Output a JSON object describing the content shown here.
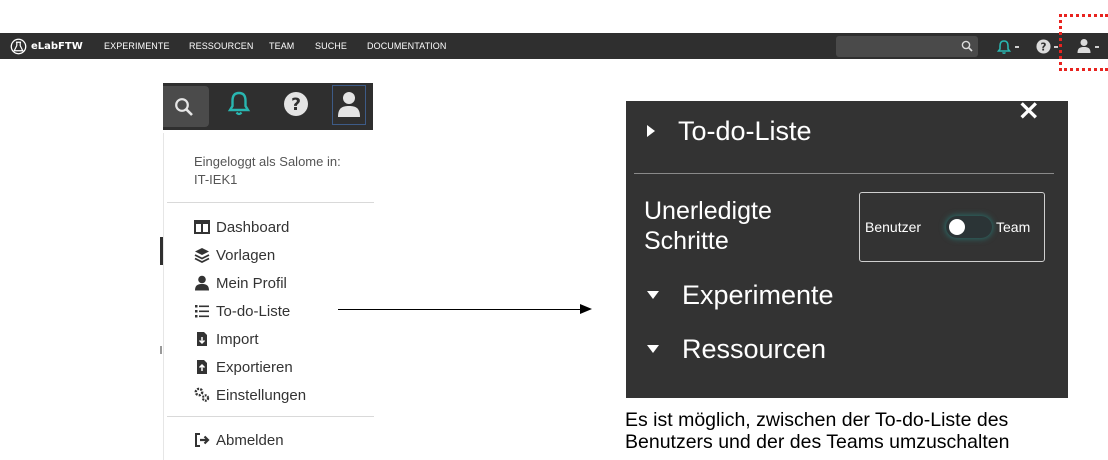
{
  "navbar": {
    "brand": "eLabFTW",
    "items": [
      "EXPERIMENTE",
      "RESSOURCEN",
      "TEAM",
      "SUCHE",
      "DOCUMENTATION"
    ]
  },
  "dropdown": {
    "logged_in_line1": "Eingeloggt als Salome in:",
    "logged_in_line2": "IT-IEK1",
    "items": [
      {
        "label": "Dashboard",
        "icon": "columns-icon"
      },
      {
        "label": "Vorlagen",
        "icon": "layers-icon"
      },
      {
        "label": "Mein Profil",
        "icon": "user-icon"
      },
      {
        "label": "To-do-Liste",
        "icon": "list-icon"
      },
      {
        "label": "Import",
        "icon": "file-import-icon"
      },
      {
        "label": "Exportieren",
        "icon": "file-export-icon"
      },
      {
        "label": "Einstellungen",
        "icon": "cogs-icon"
      }
    ],
    "logout": {
      "label": "Abmelden",
      "icon": "sign-out-icon"
    }
  },
  "todo_panel": {
    "close": "×",
    "title": "To-do-Liste",
    "unerledigte_line1": "Unerledigte",
    "unerledigte_line2": "Schritte",
    "toggle_left": "Benutzer",
    "toggle_right": "Team",
    "sections": [
      "Experimente",
      "Ressourcen"
    ]
  },
  "caption": {
    "line1": "Es ist möglich, zwischen der To-do-Liste des",
    "line2": "Benutzers und der des Teams umzuschalten"
  },
  "colors": {
    "navbar_bg": "#2f2f2f",
    "accent_teal": "#29b6b0",
    "highlight_red": "#e8231f",
    "panel_bg": "#333333"
  }
}
